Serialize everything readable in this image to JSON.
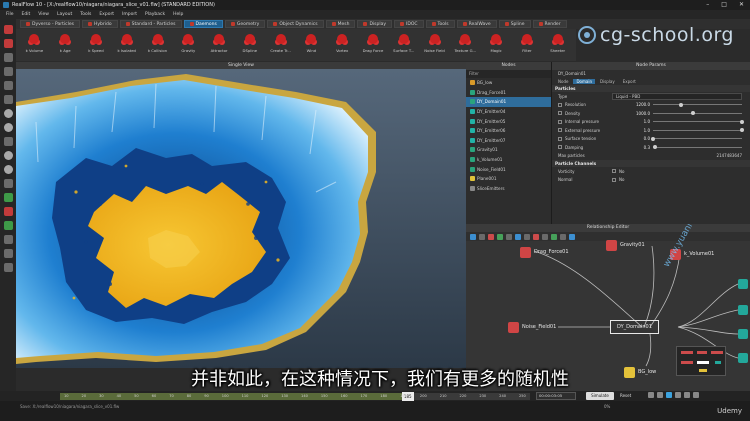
{
  "window": {
    "title": "RealFlow 10 - [X:/realflow10/niagara/niagara_slice_v01.flw] (STANDARD EDITION)",
    "controls": [
      "–",
      "□",
      "✕"
    ]
  },
  "menu": [
    "File",
    "Edit",
    "View",
    "Layout",
    "Tools",
    "Export",
    "Import",
    "Playback",
    "Help"
  ],
  "shelf_tabs": [
    {
      "label": "Dyverso - Particles",
      "active": false
    },
    {
      "label": "Hybrido",
      "active": false
    },
    {
      "label": "Standard - Particles",
      "active": false
    },
    {
      "label": "Daemons",
      "active": true
    },
    {
      "label": "Geometry",
      "active": false
    },
    {
      "label": "Object Dynamics",
      "active": false
    },
    {
      "label": "Mesh",
      "active": false
    },
    {
      "label": "Display",
      "active": false
    },
    {
      "label": "IDOC",
      "active": false
    },
    {
      "label": "Tools",
      "active": false
    },
    {
      "label": "RealWave",
      "active": false
    },
    {
      "label": "Spline",
      "active": false
    },
    {
      "label": "Render",
      "active": false
    }
  ],
  "daemon_icons": [
    "k Volume",
    "k Age",
    "k Speed",
    "k Isolated",
    "k Collision",
    "Gravity",
    "Attractor",
    "DSpline",
    "Create Tr...",
    "Wind",
    "Vortex",
    "Drag Force",
    "Surface T...",
    "Noise Field",
    "Texture G...",
    "Magic",
    "Filter",
    "Sheeter",
    "Ocean Pa...",
    "Crown",
    "Particle S...",
    "Other",
    "Plugins"
  ],
  "watermark": "cg-school.org",
  "viewport": {
    "title": "Single View"
  },
  "nodes_panel": {
    "title": "Nodes",
    "filter": "Filter",
    "items": [
      {
        "name": "BG_low",
        "color": "orange",
        "selected": false
      },
      {
        "name": "Drag_Force01",
        "color": "green",
        "selected": false
      },
      {
        "name": "DY_Domain01",
        "color": "green",
        "selected": true
      },
      {
        "name": "DY_Emitter04",
        "color": "teal",
        "selected": false
      },
      {
        "name": "DY_Emitter05",
        "color": "teal",
        "selected": false
      },
      {
        "name": "DY_Emitter06",
        "color": "teal",
        "selected": false
      },
      {
        "name": "DY_Emitter07",
        "color": "teal",
        "selected": false
      },
      {
        "name": "Gravity01",
        "color": "green",
        "selected": false
      },
      {
        "name": "k_Volume01",
        "color": "green",
        "selected": false
      },
      {
        "name": "Noise_Field01",
        "color": "green",
        "selected": false
      },
      {
        "name": "Plane001",
        "color": "yellow",
        "selected": false
      },
      {
        "name": "SliceEmitters",
        "color": "grey",
        "selected": false
      }
    ]
  },
  "params_panel": {
    "title": "Node Params",
    "node_name": "DY_Domain01",
    "tabs": [
      {
        "label": "Node",
        "active": false
      },
      {
        "label": "Domain",
        "active": true
      },
      {
        "label": "Display",
        "active": false
      },
      {
        "label": "Export",
        "active": false
      }
    ],
    "section_particles": "Particles",
    "type_label": "Type",
    "type_value": "Liquid - PBD",
    "rows": [
      {
        "name": "Resolution",
        "value": "1200.0",
        "fill": 0.32
      },
      {
        "name": "Density",
        "value": "1000.0",
        "fill": 0.45
      },
      {
        "name": "Internal pressure",
        "value": "1.0",
        "fill": 1.0
      },
      {
        "name": "External pressure",
        "value": "1.0",
        "fill": 1.0
      },
      {
        "name": "Surface tension",
        "value": "0.0",
        "fill": 0.0
      },
      {
        "name": "Damping",
        "value": "0.3",
        "fill": 0.02
      }
    ],
    "max_particles_label": "Max particles",
    "max_particles_value": "2147483647",
    "section_channels": "Particle Channels",
    "channels": [
      {
        "name": "Vorticity",
        "value": "No"
      },
      {
        "name": "Normal",
        "value": "No"
      }
    ]
  },
  "relationship_editor": {
    "title": "Relationship Editor",
    "nodes": [
      {
        "id": "drag",
        "label": "Drag_Force01",
        "kind": "red"
      },
      {
        "id": "gravity",
        "label": "Gravity01",
        "kind": "red"
      },
      {
        "id": "kvolume",
        "label": "k_Volume01",
        "kind": "red"
      },
      {
        "id": "noise",
        "label": "Noise_Field01",
        "kind": "red"
      },
      {
        "id": "domain",
        "label": "DY_Domain01",
        "kind": "domain"
      },
      {
        "id": "bglow",
        "label": "BG_low",
        "kind": "yellow"
      }
    ],
    "vertical_watermark": "www.yuanleshi.com"
  },
  "subtitle": "并非如此，在这种情况下，我们有更多的随机性",
  "timeline": {
    "ticks": [
      "10",
      "20",
      "30",
      "40",
      "50",
      "60",
      "70",
      "80",
      "90",
      "100",
      "110",
      "120",
      "130",
      "140",
      "150",
      "160",
      "170",
      "180",
      "190",
      "200",
      "210",
      "220",
      "230",
      "240",
      "250"
    ],
    "current_frame": "185",
    "progress": 0.74,
    "time_display": "00:00:03:05",
    "simulate_label": "Simulate",
    "reset_label": "Reset"
  },
  "status": {
    "message": "Save: X:/realflow10/niagara/niagara_slice_v01.flw",
    "zoom": "0%",
    "brand": "Udemy"
  },
  "colors": {
    "accent": "#2f6d9c",
    "fluid_yellow": "#f2b81e",
    "fluid_blue": "#1f86d6",
    "daemon_red": "#cc2b2b"
  }
}
